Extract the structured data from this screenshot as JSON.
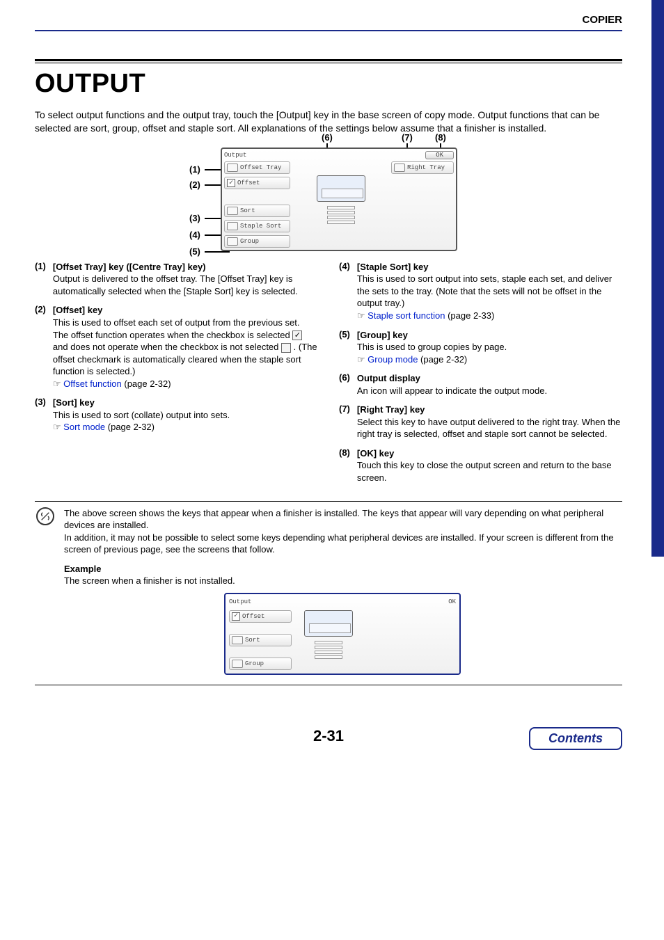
{
  "header": {
    "section": "COPIER"
  },
  "title": "OUTPUT",
  "intro": "To select output functions and the output tray, touch the [Output] key in the base screen of copy mode. Output functions that can be selected are sort, group, offset and staple sort. All explanations of the settings below assume that a finisher is installed.",
  "panel": {
    "title": "Output",
    "ok": "OK",
    "offset_tray": "Offset Tray",
    "offset": "Offset",
    "sort": "Sort",
    "staple_sort": "Staple Sort",
    "group": "Group",
    "right_tray": "Right Tray"
  },
  "callouts": {
    "c1": "(1)",
    "c2": "(2)",
    "c3": "(3)",
    "c4": "(4)",
    "c5": "(5)",
    "c6": "(6)",
    "c7": "(7)",
    "c8": "(8)"
  },
  "items_left": [
    {
      "num": "(1)",
      "title": "[Offset Tray] key ([Centre Tray] key)",
      "body": "Output is delivered to the offset tray. The [Offset Tray] key is automatically selected when the [Staple Sort] key is selected."
    },
    {
      "num": "(2)",
      "title": "[Offset] key",
      "body_a": "This is used to offset each set of output from the previous set.",
      "body_b_pre": "The offset function operates when the checkbox is selected ",
      "body_b_mid": " and does not operate when the checkbox is not selected ",
      "body_b_post": ". (The offset checkmark is automatically cleared when the staple sort function is selected.)",
      "link": "Offset function",
      "pg": " (page 2-32)"
    },
    {
      "num": "(3)",
      "title": "[Sort] key",
      "body": "This is used to sort (collate) output into sets.",
      "link": "Sort mode",
      "pg": " (page 2-32)"
    }
  ],
  "items_right": [
    {
      "num": "(4)",
      "title": "[Staple Sort] key",
      "body": "This is used to sort output into sets, staple each set, and deliver the sets to the tray. (Note that the sets will not be offset in the output tray.)",
      "link": "Staple sort function",
      "pg": " (page 2-33)"
    },
    {
      "num": "(5)",
      "title": "[Group] key",
      "body": "This is used to group copies by page.",
      "link": "Group mode",
      "pg": " (page 2-32)"
    },
    {
      "num": "(6)",
      "title": "Output display",
      "body": "An icon will appear to indicate the output mode."
    },
    {
      "num": "(7)",
      "title": "[Right Tray] key",
      "body": "Select this key to have output delivered to the right tray. When the right tray is selected, offset and staple sort cannot be selected."
    },
    {
      "num": "(8)",
      "title": "[OK] key",
      "body": "Touch this key to close the output screen and return to the base screen."
    }
  ],
  "note": {
    "p1": "The above screen shows the keys that appear when a finisher is installed. The keys that appear will vary depending on what peripheral devices are installed.",
    "p2": "In addition, it may not be possible to select some keys depending what peripheral devices are installed. If your screen is different from the screen of previous page, see the screens that follow.",
    "example_lbl": "Example",
    "example_txt": "The screen when a finisher is not installed."
  },
  "panel2": {
    "title": "Output",
    "ok": "OK",
    "offset": "Offset",
    "sort": "Sort",
    "group": "Group"
  },
  "footer": {
    "page": "2-31",
    "contents": "Contents"
  }
}
